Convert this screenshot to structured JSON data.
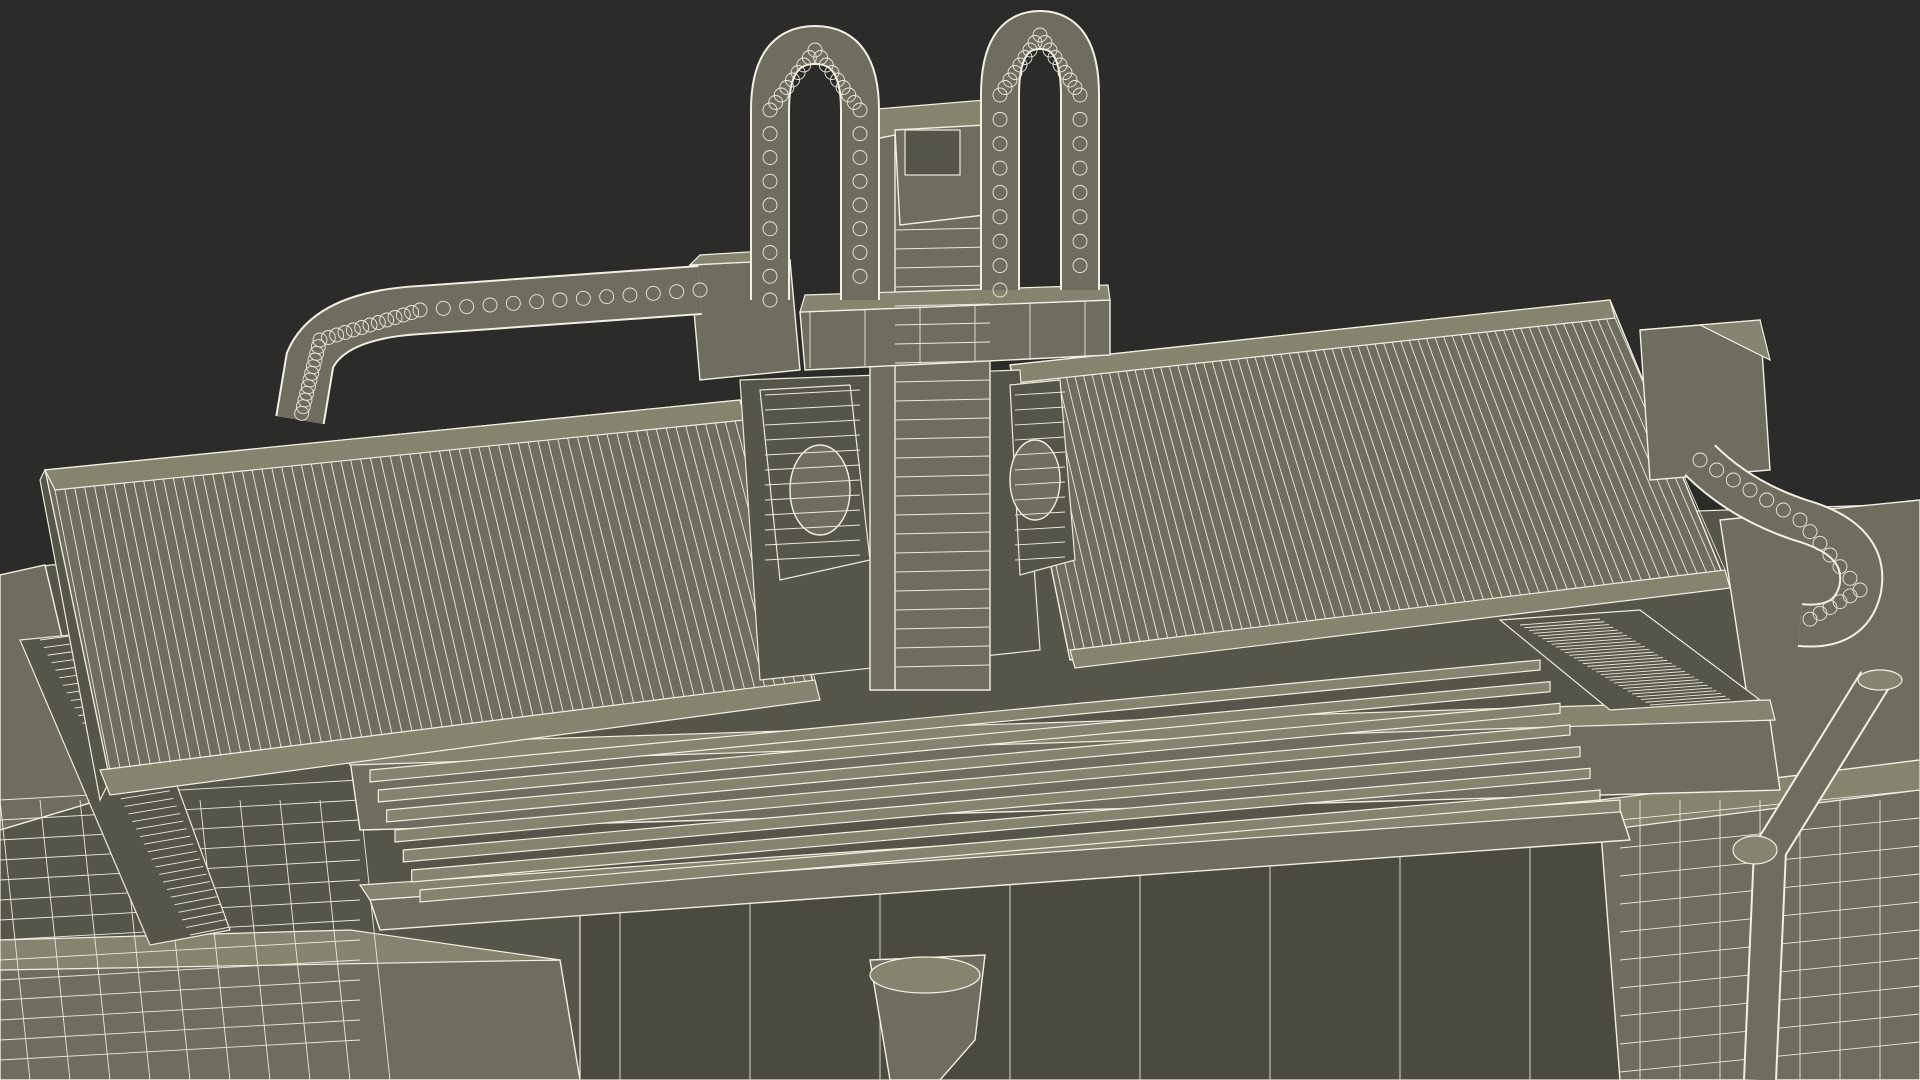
{
  "colors": {
    "background": "#2b2b2a",
    "model_fill": "#6e6d60",
    "model_shadow": "#55554a",
    "model_highlight": "#85846f",
    "wireframe": "#f3f0e2"
  },
  "subject": {
    "left_bellows_folds": 70,
    "right_bellows_folds": 70,
    "bed_rails": 7
  }
}
